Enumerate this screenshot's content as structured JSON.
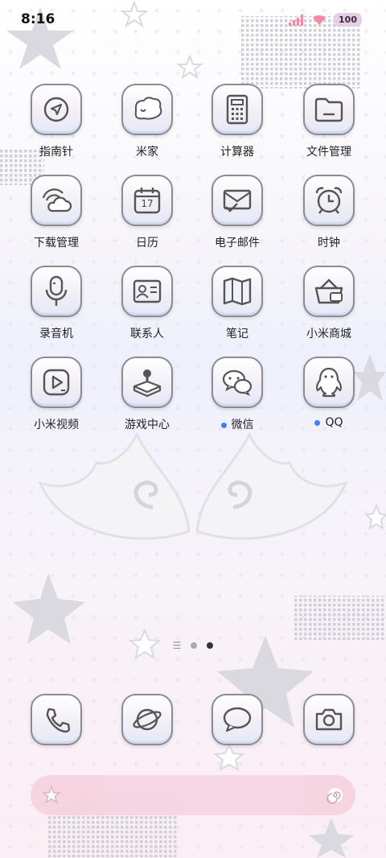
{
  "status_bar": {
    "time": "8:16",
    "battery": "100",
    "icons": [
      "signal-icon",
      "wifi-icon",
      "battery-icon"
    ]
  },
  "apps": [
    {
      "label": "指南针",
      "icon": "compass-icon"
    },
    {
      "label": "米家",
      "icon": "mijia-icon"
    },
    {
      "label": "计算器",
      "icon": "calculator-icon"
    },
    {
      "label": "文件管理",
      "icon": "folder-icon"
    },
    {
      "label": "下载管理",
      "icon": "download-cloud-icon"
    },
    {
      "label": "日历",
      "icon": "calendar-icon",
      "day": "17"
    },
    {
      "label": "电子邮件",
      "icon": "email-icon"
    },
    {
      "label": "时钟",
      "icon": "alarm-clock-icon"
    },
    {
      "label": "录音机",
      "icon": "microphone-icon"
    },
    {
      "label": "联系人",
      "icon": "contact-card-icon"
    },
    {
      "label": "笔记",
      "icon": "notes-book-icon"
    },
    {
      "label": "小米商城",
      "icon": "shopping-basket-icon"
    },
    {
      "label": "小米视频",
      "icon": "video-play-icon"
    },
    {
      "label": "游戏中心",
      "icon": "joystick-icon"
    },
    {
      "label": "微信",
      "icon": "wechat-icon",
      "badge_dot": true
    },
    {
      "label": "QQ",
      "icon": "qq-penguin-icon",
      "badge_dot": true
    }
  ],
  "pager": {
    "pages": 2,
    "active": 2
  },
  "dock": [
    {
      "icon": "phone-icon"
    },
    {
      "icon": "browser-planet-icon"
    },
    {
      "icon": "messages-icon"
    },
    {
      "icon": "camera-icon"
    }
  ],
  "colors": {
    "accent_dot": "#3b82f6",
    "search_bar": "#f6d4e0",
    "battery_bg": "#e6cfe6"
  }
}
